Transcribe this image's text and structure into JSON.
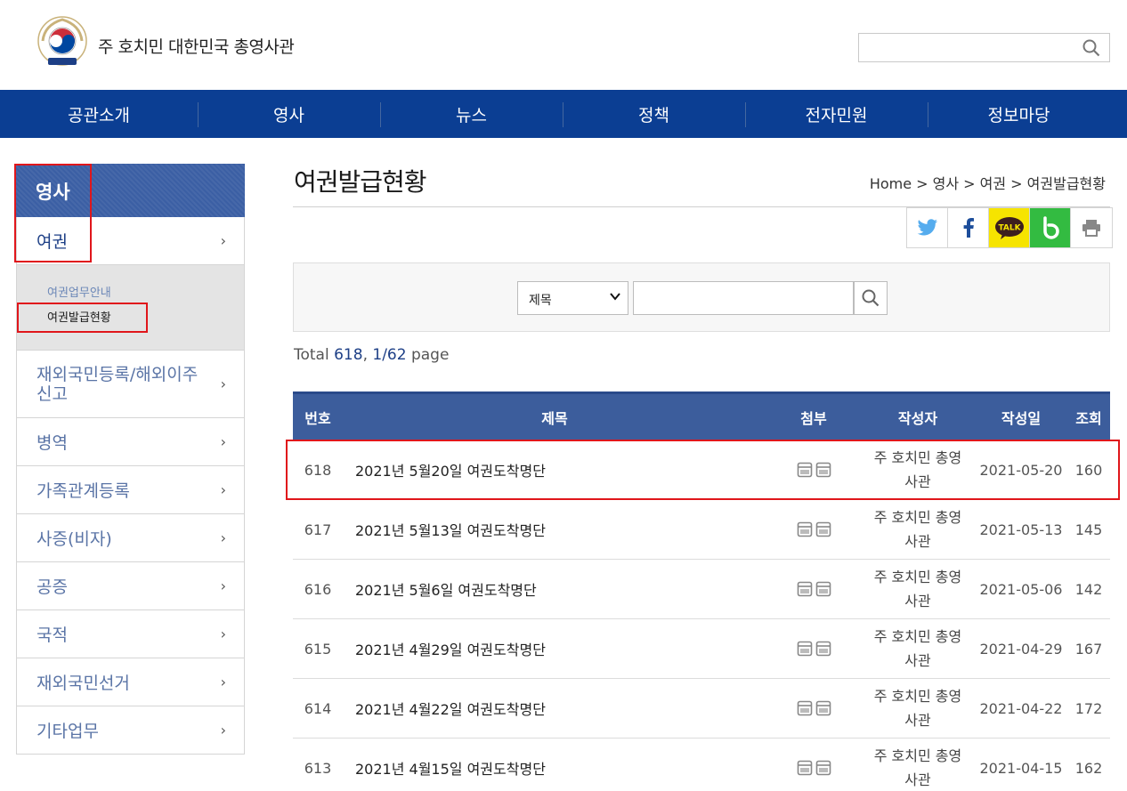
{
  "header": {
    "site_title": "주 호치민 대한민국 총영사관",
    "search_placeholder": ""
  },
  "gnb": [
    "공관소개",
    "영사",
    "뉴스",
    "정책",
    "전자민원",
    "정보마당"
  ],
  "sidebar": {
    "heading": "영사",
    "items": [
      {
        "label": "여권"
      },
      {
        "label": "재외국민등록/해외이주신고"
      },
      {
        "label": "병역"
      },
      {
        "label": "가족관계등록"
      },
      {
        "label": "사증(비자)"
      },
      {
        "label": "공증"
      },
      {
        "label": "국적"
      },
      {
        "label": "재외국민선거"
      },
      {
        "label": "기타업무"
      }
    ],
    "sub_items": [
      "여권업무안내",
      "여권발급현황"
    ],
    "long_item_line1": "재외국민등록/해외이주",
    "long_item_line2": "신고"
  },
  "page": {
    "title": "여권발급현황",
    "breadcrumb": "Home > 영사 > 여권 > 여권발급현황"
  },
  "share": {
    "kakao_label": "TALK"
  },
  "search": {
    "field_selected": "제목",
    "dropdown_icon": "chevron-down",
    "keyword": ""
  },
  "total": {
    "prefix": "Total ",
    "count": "618",
    "sep": ", ",
    "page": "1/62",
    "suffix": " page"
  },
  "board": {
    "columns": [
      "번호",
      "제목",
      "첨부",
      "작성자",
      "작성일",
      "조회"
    ],
    "rows": [
      {
        "no": "618",
        "title": "2021년 5월20일 여권도착명단",
        "writer": "주 호치민 총영사관",
        "date": "2021-05-20",
        "hits": "160"
      },
      {
        "no": "617",
        "title": "2021년 5월13일 여권도착명단",
        "writer": "주 호치민 총영사관",
        "date": "2021-05-13",
        "hits": "145"
      },
      {
        "no": "616",
        "title": "2021년 5월6일 여권도착명단",
        "writer": "주 호치민 총영사관",
        "date": "2021-05-06",
        "hits": "142"
      },
      {
        "no": "615",
        "title": "2021년 4월29일 여권도착명단",
        "writer": "주 호치민 총영사관",
        "date": "2021-04-29",
        "hits": "167"
      },
      {
        "no": "614",
        "title": "2021년 4월22일 여권도착명단",
        "writer": "주 호치민 총영사관",
        "date": "2021-04-22",
        "hits": "172"
      },
      {
        "no": "613",
        "title": "2021년 4월15일 여권도착명단",
        "writer": "주 호치민 총영사관",
        "date": "2021-04-15",
        "hits": "162"
      }
    ]
  },
  "colors": {
    "nav_bg": "#0b3e93",
    "table_head": "#3c5d9c",
    "highlight": "#e0161b"
  }
}
